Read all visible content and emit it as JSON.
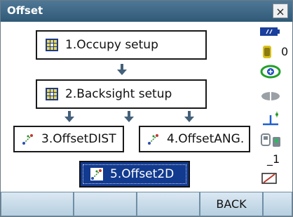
{
  "window": {
    "title": "Offset",
    "close_label": "×"
  },
  "menu": {
    "items": [
      {
        "label": "1.Occupy setup"
      },
      {
        "label": "2.Backsight setup"
      },
      {
        "label": "3.OffsetDIST"
      },
      {
        "label": "4.OffsetANG."
      },
      {
        "label": "5.Offset2D"
      }
    ],
    "selected_index": 4
  },
  "status": {
    "battery_icon": "battery-icon",
    "memory_count": "0",
    "prism_icon": "prism-target-icon",
    "laser_icon": "laser-icon",
    "tilt_icon": "tilt-icon",
    "interface_icon": "bluetooth-interface-icon",
    "input_mode": "_1",
    "edit_icon": "pencil-icon"
  },
  "softkeys": [
    "",
    "",
    "",
    "BACK",
    ""
  ],
  "colors": {
    "title_bar": "#3d6685",
    "selected": "#123a8f",
    "softkey": "#c7dae8"
  }
}
